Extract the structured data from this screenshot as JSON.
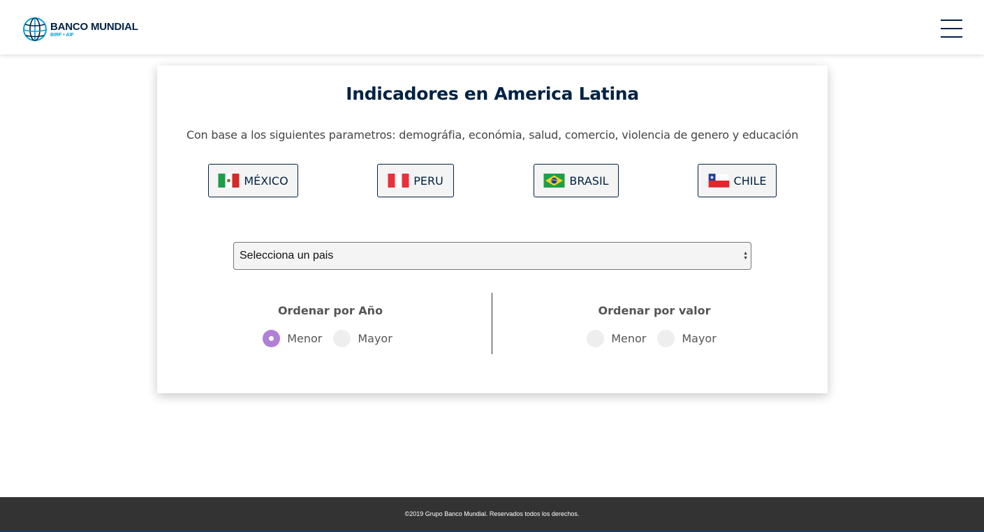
{
  "header": {
    "logo_title": "BANCO MUNDIAL",
    "logo_subtitle": "BIRF • AIF",
    "menu_icon": "hamburger-menu-icon",
    "brand_color": "#002244",
    "accent_color": "#009fda"
  },
  "main": {
    "title": "Indicadores en America Latina",
    "subtitle": "Con base a los siguientes parametros: demográfia, económia, salud, comercio, violencia de genero y educación",
    "countries": [
      {
        "label": "MÉXICO",
        "flag": "mexico-flag-icon"
      },
      {
        "label": "PERU",
        "flag": "peru-flag-icon"
      },
      {
        "label": "BRASIL",
        "flag": "brazil-flag-icon"
      },
      {
        "label": "CHILE",
        "flag": "chile-flag-icon"
      }
    ],
    "country_select": {
      "selected": "Selecciona un pais"
    },
    "sort_year": {
      "title": "Ordenar por Año",
      "options": [
        {
          "label": "Menor",
          "checked": true
        },
        {
          "label": "Mayor",
          "checked": false
        }
      ]
    },
    "sort_value": {
      "title": "Ordenar por valor",
      "options": [
        {
          "label": "Menor",
          "checked": false
        },
        {
          "label": "Mayor",
          "checked": false
        }
      ]
    },
    "radio_checked_color": "#b17fd6"
  },
  "footer": {
    "text": "©2019 Grupo Banco Mundial. Reservados todos los derechos."
  }
}
